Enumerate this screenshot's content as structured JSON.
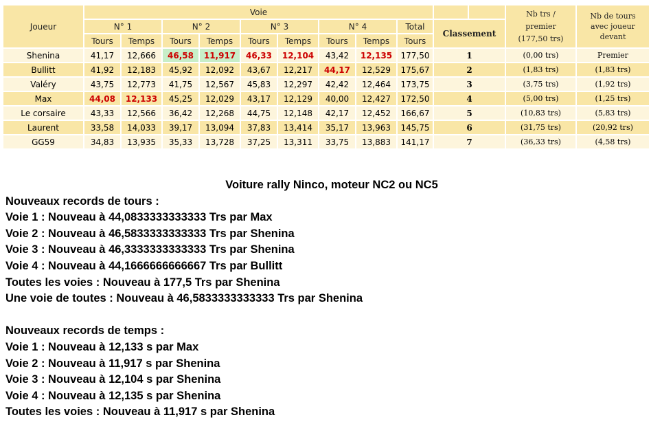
{
  "headers": {
    "joueur": "Joueur",
    "voie": "Voie",
    "lanes": [
      "N° 1",
      "N° 2",
      "N° 3",
      "N° 4"
    ],
    "tours": "Tours",
    "temps": "Temps",
    "total": "Total",
    "total_sub": "Tours",
    "classement": "Classement",
    "nb_trs_1": "Nb trs /",
    "nb_trs_2": "premier",
    "nb_trs_3": "(177,50 trs)",
    "nb_tours_1": "Nb de tours",
    "nb_tours_2": "avec joueur",
    "nb_tours_3": "devant"
  },
  "rows": [
    {
      "name": "Shenina",
      "l1t": "41,17",
      "l1s": "12,666",
      "l2t": "46,58",
      "l2s": "11,917",
      "l3t": "46,33",
      "l3s": "12,104",
      "l4t": "43,42",
      "l4s": "12,135",
      "total": "177,50",
      "rank": "1",
      "gap_first": "(0,00 trs)",
      "gap_prev": "Premier"
    },
    {
      "name": "Bullitt",
      "l1t": "41,92",
      "l1s": "12,183",
      "l2t": "45,92",
      "l2s": "12,092",
      "l3t": "43,67",
      "l3s": "12,217",
      "l4t": "44,17",
      "l4s": "12,529",
      "total": "175,67",
      "rank": "2",
      "gap_first": "(1,83 trs)",
      "gap_prev": "(1,83 trs)"
    },
    {
      "name": "Valéry",
      "l1t": "43,75",
      "l1s": "12,773",
      "l2t": "41,75",
      "l2s": "12,567",
      "l3t": "45,83",
      "l3s": "12,297",
      "l4t": "42,42",
      "l4s": "12,464",
      "total": "173,75",
      "rank": "3",
      "gap_first": "(3,75 trs)",
      "gap_prev": "(1,92 trs)"
    },
    {
      "name": "Max",
      "l1t": "44,08",
      "l1s": "12,133",
      "l2t": "45,25",
      "l2s": "12,029",
      "l3t": "43,17",
      "l3s": "12,129",
      "l4t": "40,00",
      "l4s": "12,427",
      "total": "172,50",
      "rank": "4",
      "gap_first": "(5,00 trs)",
      "gap_prev": "(1,25 trs)"
    },
    {
      "name": "Le corsaire",
      "l1t": "43,33",
      "l1s": "12,566",
      "l2t": "36,42",
      "l2s": "12,268",
      "l3t": "44,75",
      "l3s": "12,148",
      "l4t": "42,17",
      "l4s": "12,452",
      "total": "166,67",
      "rank": "5",
      "gap_first": "(10,83 trs)",
      "gap_prev": "(5,83 trs)"
    },
    {
      "name": "Laurent",
      "l1t": "33,58",
      "l1s": "14,033",
      "l2t": "39,17",
      "l2s": "13,094",
      "l3t": "37,83",
      "l3s": "13,414",
      "l4t": "35,17",
      "l4s": "13,963",
      "total": "145,75",
      "rank": "6",
      "gap_first": "(31,75 trs)",
      "gap_prev": "(20,92 trs)"
    },
    {
      "name": "GG59",
      "l1t": "34,83",
      "l1s": "13,935",
      "l2t": "35,33",
      "l2s": "13,728",
      "l3t": "37,25",
      "l3s": "13,311",
      "l4t": "33,75",
      "l4s": "13,883",
      "total": "141,17",
      "rank": "7",
      "gap_first": "(36,33 trs)",
      "gap_prev": "(4,58 trs)"
    }
  ],
  "text": {
    "title": "Voiture rally Ninco, moteur NC2 ou NC5",
    "tours_heading": "Nouveaux records de tours :",
    "tours_lines": [
      "Voie 1 : Nouveau à 44,0833333333333 Trs par Max",
      "Voie 2 : Nouveau à 46,5833333333333 Trs par Shenina",
      "Voie 3 : Nouveau à 46,3333333333333 Trs par Shenina",
      "Voie 4 : Nouveau à 44,1666666666667 Trs par Bullitt",
      "Toutes les voies : Nouveau à 177,5 Trs par Shenina",
      "Une voie de toutes : Nouveau à 46,5833333333333 Trs par Shenina"
    ],
    "temps_heading": "Nouveaux records de temps :",
    "temps_lines": [
      "Voie 1 : Nouveau à 12,133 s par Max",
      "Voie 2 : Nouveau à 11,917 s par Shenina",
      "Voie 3 : Nouveau à 12,104 s par Shenina",
      "Voie 4 : Nouveau à 12,135 s par Shenina",
      "Toutes les voies : Nouveau à 11,917 s par Shenina"
    ]
  }
}
